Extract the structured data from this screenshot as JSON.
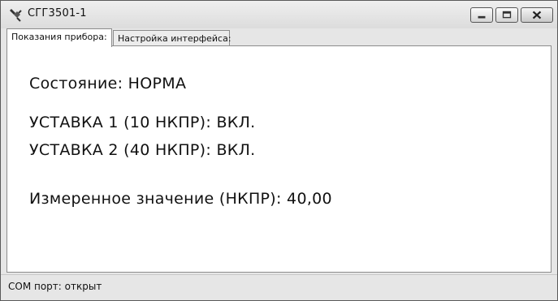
{
  "window": {
    "title": "СГГ3501-1",
    "icon": "plug-icon"
  },
  "tabs": [
    {
      "label": "Показания прибора:",
      "active": true
    },
    {
      "label": "Настройка интерфейса:",
      "active": false
    }
  ],
  "readings": {
    "state": "Состояние: НОРМА",
    "setpoint1": "УСТАВКА 1 (10 НКПР): ВКЛ.",
    "setpoint2": "УСТАВКА 2 (40 НКПР): ВКЛ.",
    "measured": "Измеренное значение (НКПР): 40,00"
  },
  "status": {
    "text": "COM порт: открыт"
  }
}
